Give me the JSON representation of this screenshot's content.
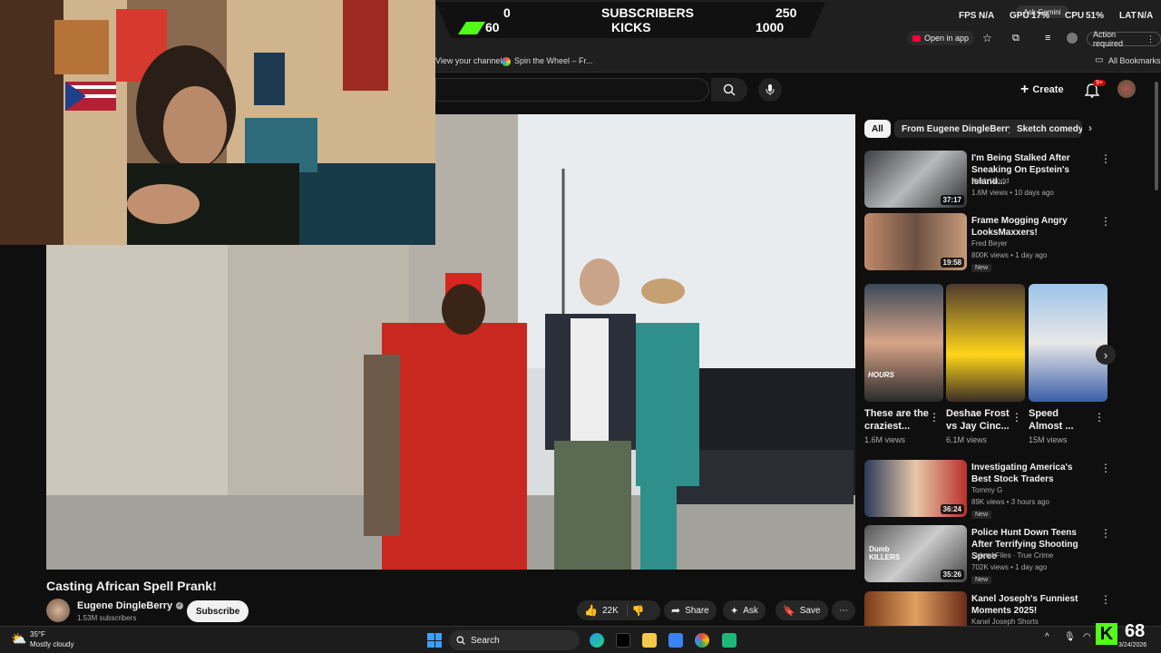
{
  "overlay": {
    "left_top": "0",
    "left_bottom": "60",
    "label_top": "SUBSCRIBERS",
    "label_bottom": "KICKS",
    "right_top": "250",
    "right_bottom": "1000"
  },
  "system": {
    "fps_label": "FPS",
    "fps_value": "N/A",
    "gpu_label": "GPU",
    "gpu_value": "17%",
    "cpu_label": "CPU",
    "cpu_value": "51%",
    "lat_label": "LAT",
    "lat_value": "N/A",
    "ask_gemini": "Ask Gemini"
  },
  "browser": {
    "new_tab": "+",
    "open_in_app": "Open in app",
    "action_required": "Action required",
    "bookmark_1": "View your channel",
    "bookmark_2": "Spin the Wheel – Fr...",
    "all_bookmarks": "All Bookmarks"
  },
  "header": {
    "create_label": "Create",
    "notif_count": "9+"
  },
  "video": {
    "title": "Casting African Spell Prank!",
    "channel": "Eugene DingleBerry",
    "subscribers": "1.53M subscribers",
    "subscribe_label": "Subscribe",
    "likes": "22K",
    "share_label": "Share",
    "ask_label": "Ask",
    "save_label": "Save"
  },
  "chips": [
    "All",
    "From Eugene DingleBerry",
    "Sketch comedy"
  ],
  "recommendations": [
    {
      "title": "I'm Being Stalked After Sneaking On Epstein's Island...",
      "channel": "Kash World",
      "meta": "1.6M views • 10 days ago",
      "duration": "37:17",
      "new": "",
      "verified": false
    },
    {
      "title": "Frame Mogging Angry LooksMaxxers!",
      "channel": "Fred Beyer",
      "meta": "800K views • 1 day ago",
      "duration": "19:58",
      "new": "New",
      "verified": true
    },
    {
      "title": "Investigating America's Best Stock Traders",
      "channel": "Tommy G",
      "meta": "89K views • 3 hours ago",
      "duration": "36:24",
      "new": "New",
      "verified": true
    },
    {
      "title": "Police Hunt Down Teens After Terrifying Shooting Spree",
      "channel": "Solved Files · True Crime",
      "meta": "702K views • 1 day ago",
      "duration": "35:26",
      "new": "New",
      "verified": true
    },
    {
      "title": "Kanel Joseph's Funniest Moments 2025!",
      "channel": "Kanel Joseph Shorts",
      "meta": "",
      "duration": "",
      "new": "",
      "verified": false
    }
  ],
  "shorts": [
    {
      "title": "These are the craziest...",
      "views": "1.6M views",
      "overlay": "HOURS"
    },
    {
      "title": "Deshae Frost vs Jay Cinc...",
      "views": "6.1M views",
      "overlay": ""
    },
    {
      "title": "Speed Almost ...",
      "views": "15M views",
      "overlay": ""
    }
  ],
  "thumb_text": {
    "dumb_killers": "Dumb KILLERS"
  },
  "taskbar": {
    "weather_temp": "35°F",
    "weather_desc": "Mostly cloudy",
    "search": "Search",
    "kick_count": "68",
    "date": "3/24/2026"
  },
  "colors": {
    "accent_red": "#ff0033",
    "kick_green": "#53fc18",
    "yt_bg": "#0f0f0f"
  }
}
